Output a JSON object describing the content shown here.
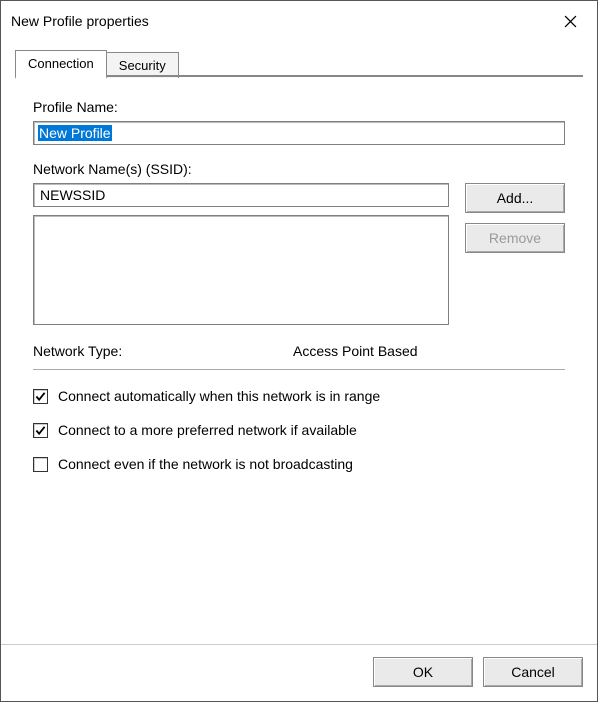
{
  "window": {
    "title": "New Profile properties"
  },
  "tabs": {
    "connection": "Connection",
    "security": "Security"
  },
  "profile": {
    "name_label": "Profile Name:",
    "name_value": "New Profile"
  },
  "ssid": {
    "label": "Network Name(s) (SSID):",
    "value": "NEWSSID",
    "add_label": "Add...",
    "remove_label": "Remove"
  },
  "network_type": {
    "label": "Network Type:",
    "value": "Access Point Based"
  },
  "options": {
    "auto_connect": "Connect automatically when this network is in range",
    "prefer_network": "Connect to a more preferred network if available",
    "not_broadcasting": "Connect even if the network is not broadcasting"
  },
  "footer": {
    "ok": "OK",
    "cancel": "Cancel"
  }
}
